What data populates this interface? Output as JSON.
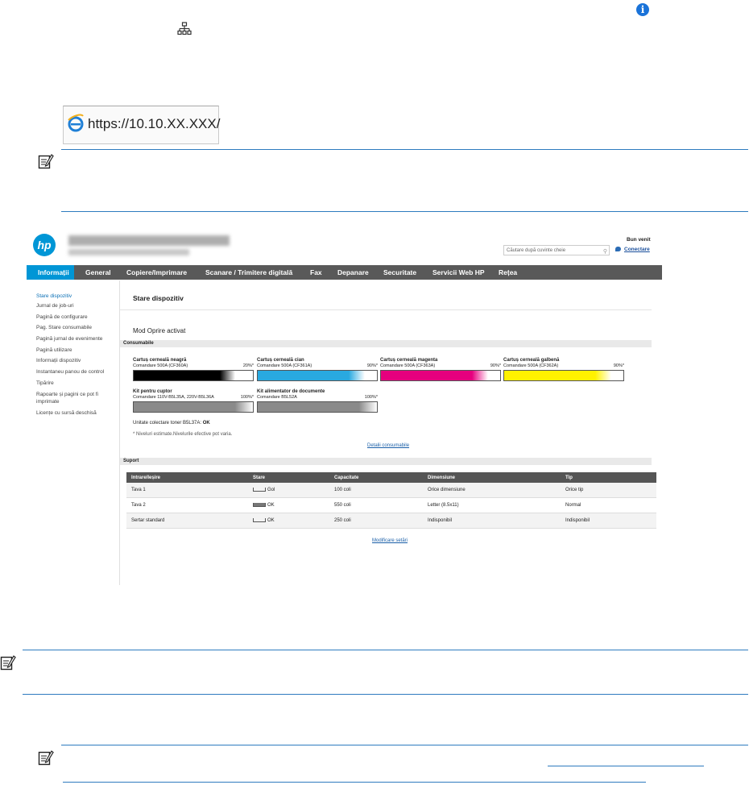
{
  "url_bar": {
    "address": "https://10.10.XX.XXX/"
  },
  "ews": {
    "header": {
      "search_placeholder": "Căutare după cuvinte cheie",
      "welcome": "Bun venit",
      "connect": "Conectare"
    },
    "nav": [
      {
        "label": "Informații"
      },
      {
        "label": "General"
      },
      {
        "label": "Copiere/Imprimare"
      },
      {
        "label": "Scanare / Trimitere digitală"
      },
      {
        "label": "Fax"
      },
      {
        "label": "Depanare"
      },
      {
        "label": "Securitate"
      },
      {
        "label": "Servicii Web HP"
      },
      {
        "label": "Rețea"
      }
    ],
    "sidebar": [
      {
        "label": "Stare dispozitiv"
      },
      {
        "label": "Jurnal de job-uri"
      },
      {
        "label": "Pagină de configurare"
      },
      {
        "label": "Pag. Stare consumabile"
      },
      {
        "label": "Pagină jurnal de evenimente"
      },
      {
        "label": "Pagină utilizare"
      },
      {
        "label": "Informații dispozitiv"
      },
      {
        "label": "Instantaneu panou de control"
      },
      {
        "label": "Tipărire"
      },
      {
        "label": "Rapoarte și pagini ce pot fi"
      },
      {
        "label": "imprimate"
      },
      {
        "label": "Licențe cu sursă deschisă"
      }
    ],
    "content": {
      "title": "Stare dispozitiv",
      "mode": "Mod Oprire activat",
      "consumables_title": "Consumabile",
      "cartridges": [
        {
          "name": "Cartuș cerneală neagră",
          "sub": "Comandare 500A (CF360A)",
          "pct": "20%*",
          "level": 0.85,
          "color": "#000000"
        },
        {
          "name": "Cartuș cerneală cian",
          "sub": "Comandare 500A (CF361A)",
          "pct": "90%*",
          "level": 0.9,
          "color": "#29a9e0"
        },
        {
          "name": "Cartuș cerneală magenta",
          "sub": "Comandare 500A (CF363A)",
          "pct": "90%*",
          "level": 0.9,
          "color": "#e6007e"
        },
        {
          "name": "Cartuș cerneală galbenă",
          "sub": "Comandare 500A (CF362A)",
          "pct": "90%*",
          "level": 0.9,
          "color": "#fff200"
        },
        {
          "name": "Kit pentru cuptor",
          "sub": "Comandare 110V-B5L35A, 220V-B5L36A",
          "pct": "100%*",
          "level": 1.0,
          "color": "#8a8a8a"
        },
        {
          "name": "Kit alimentator de documente",
          "sub": "Comandare B5L52A",
          "pct": "100%*",
          "level": 1.0,
          "color": "#8a8a8a"
        }
      ],
      "toner_unit_label": "Unitate colectare toner B5L37A:",
      "toner_unit_status": "OK",
      "estimate_note": "* Niveluri estimate.Nivelurile efective pot varia.",
      "consumables_link": "Detalii consumabile",
      "support_title": "Suport",
      "table_headers": [
        "Intrare/Ieșire",
        "Stare",
        "Capacitate",
        "Dimensiune",
        "Tip"
      ],
      "table_rows": [
        {
          "io": "Tava 1",
          "stare": "Gol",
          "cap": "100 coli",
          "dim": "Orice dimensiune",
          "tip": "Orice tip"
        },
        {
          "io": "Tava 2",
          "stare": "OK",
          "cap": "550 coli",
          "dim": "Letter (8.5x11)",
          "tip": "Normal"
        },
        {
          "io": "Sertar standard",
          "stare": "OK",
          "cap": "250 coli",
          "dim": "Indisponibil",
          "tip": "Indisponibil"
        }
      ],
      "settings_link": "Modificare setări"
    }
  }
}
